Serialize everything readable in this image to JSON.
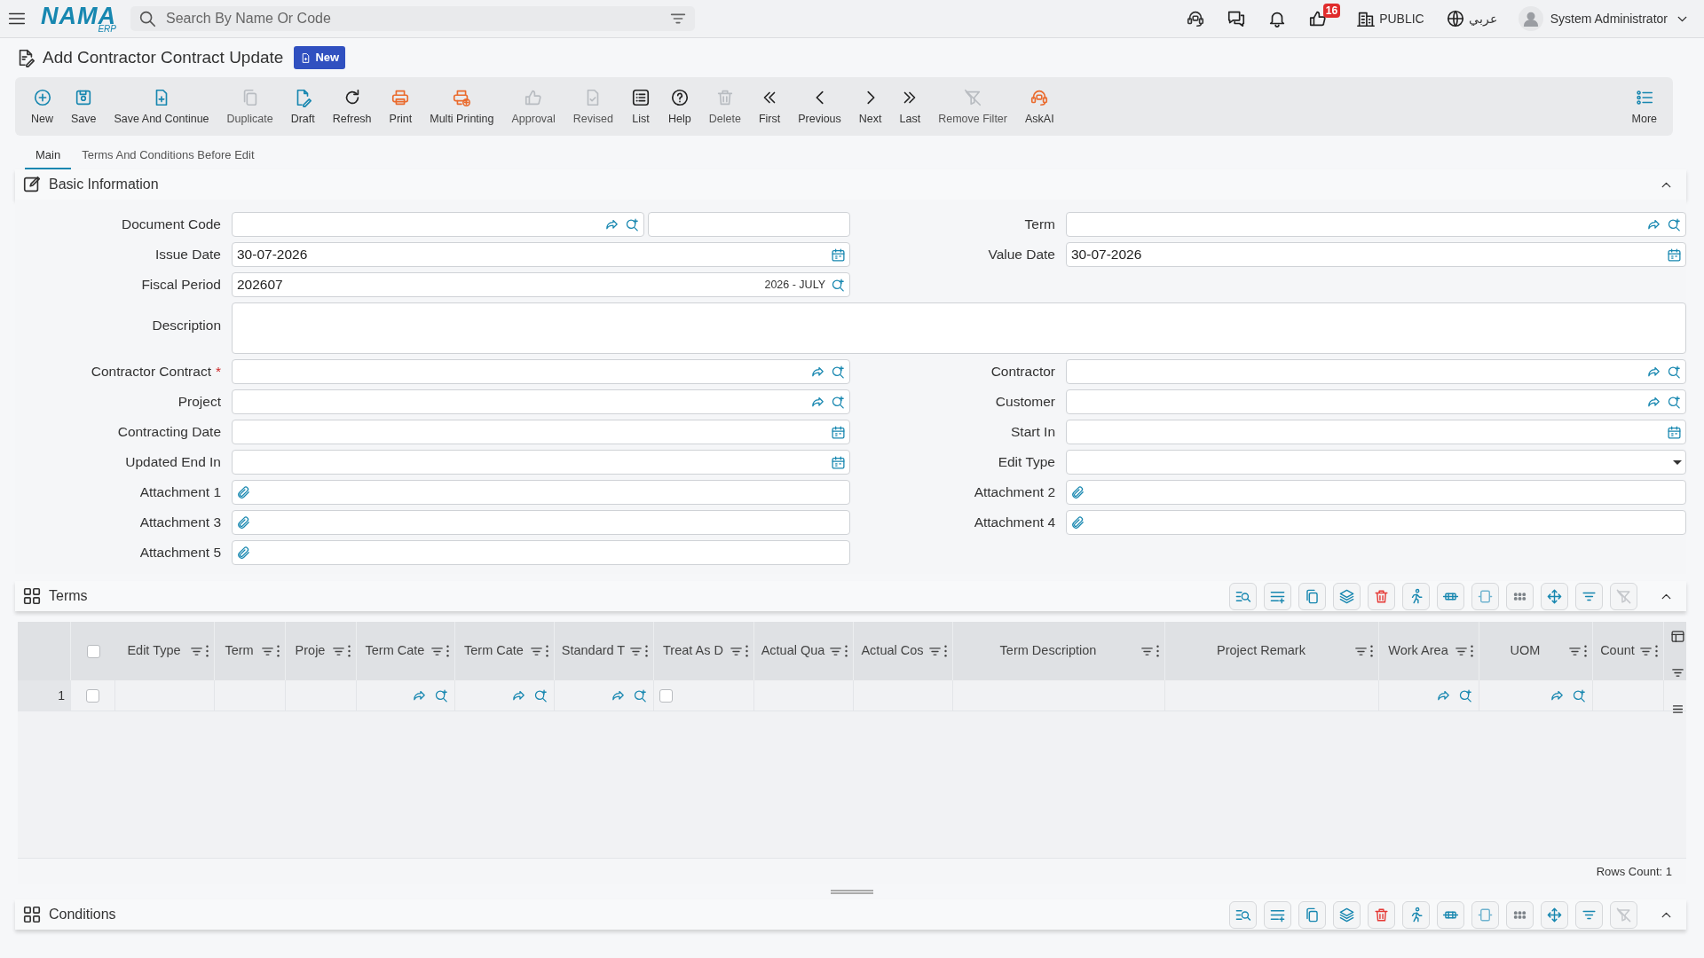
{
  "topbar": {
    "logo": {
      "name": "NAMA",
      "suffix": "ERP"
    },
    "search": {
      "placeholder": "Search By Name Or Code"
    },
    "likes_badge": "16",
    "company": "PUBLIC",
    "language": "عربي",
    "user": "System Administrator"
  },
  "page": {
    "title": "Add Contractor Contract Update",
    "status": "New"
  },
  "toolbar": [
    {
      "label": "New",
      "disabled": false
    },
    {
      "label": "Save",
      "disabled": false
    },
    {
      "label": "Save And Continue",
      "disabled": false
    },
    {
      "label": "Duplicate",
      "disabled": true
    },
    {
      "label": "Draft",
      "disabled": false
    },
    {
      "label": "Refresh",
      "disabled": false
    },
    {
      "label": "Print",
      "disabled": false
    },
    {
      "label": "Multi Printing",
      "disabled": false
    },
    {
      "label": "Approval",
      "disabled": true
    },
    {
      "label": "Revised",
      "disabled": true
    },
    {
      "label": "List",
      "disabled": false
    },
    {
      "label": "Help",
      "disabled": false
    },
    {
      "label": "Delete",
      "disabled": true
    },
    {
      "label": "First",
      "disabled": false
    },
    {
      "label": "Previous",
      "disabled": false
    },
    {
      "label": "Next",
      "disabled": false
    },
    {
      "label": "Last",
      "disabled": false
    },
    {
      "label": "Remove Filter",
      "disabled": true
    },
    {
      "label": "AskAI",
      "disabled": false
    },
    {
      "label": "More",
      "disabled": false
    }
  ],
  "tabs": [
    {
      "label": "Main",
      "selected": true
    },
    {
      "label": "Terms And Conditions Before Edit",
      "selected": false
    }
  ],
  "basic_information": {
    "title": "Basic Information",
    "expanded": true,
    "rows": [
      [
        {
          "label": "Document Code",
          "kind": "lookup_pair"
        },
        {
          "label": "Term",
          "kind": "lookup"
        }
      ],
      [
        {
          "label": "Issue Date",
          "kind": "date",
          "value": "30-07-2026"
        },
        {
          "label": "Value Date",
          "kind": "date",
          "value": "30-07-2026"
        }
      ],
      [
        {
          "label": "Fiscal Period",
          "kind": "period",
          "value": "202607",
          "period_name": "2026 - JULY"
        }
      ],
      [
        {
          "label": "Description",
          "kind": "textarea"
        }
      ],
      [
        {
          "label": "Contractor Contract",
          "kind": "lookup",
          "required_mark": "*"
        },
        {
          "label": "Contractor",
          "kind": "lookup"
        }
      ],
      [
        {
          "label": "Project",
          "kind": "lookup"
        },
        {
          "label": "Customer",
          "kind": "lookup"
        }
      ],
      [
        {
          "label": "Contracting Date",
          "kind": "date"
        },
        {
          "label": "Start In",
          "kind": "date"
        }
      ],
      [
        {
          "label": "Updated End In",
          "kind": "date"
        },
        {
          "label": "Edit Type",
          "kind": "select"
        }
      ],
      [
        {
          "label": "Attachment 1",
          "kind": "attachment"
        },
        {
          "label": "Attachment 2",
          "kind": "attachment"
        }
      ],
      [
        {
          "label": "Attachment 3",
          "kind": "attachment"
        },
        {
          "label": "Attachment 4",
          "kind": "attachment"
        }
      ],
      [
        {
          "label": "Attachment 5",
          "kind": "attachment"
        }
      ]
    ]
  },
  "terms": {
    "title": "Terms",
    "expanded": true,
    "tools": [
      {
        "disabled": false
      },
      {
        "disabled": false
      },
      {
        "disabled": false
      },
      {
        "disabled": false
      },
      {
        "disabled": false
      },
      {
        "disabled": false
      },
      {
        "disabled": false
      },
      {
        "disabled": false
      },
      {
        "disabled": false
      },
      {
        "disabled": false
      },
      {
        "disabled": false
      },
      {
        "disabled": true
      }
    ],
    "all_checked": false,
    "columns": [
      "Edit Type",
      "Term",
      "Proje",
      "Term Cate",
      "Term Cate",
      "Standard T",
      "Treat As D",
      "Actual Qua",
      "Actual Cos",
      "Term Description",
      "Project Remark",
      "Work Area",
      "UOM",
      "Count"
    ],
    "rows": [
      {
        "number": "1",
        "checked": false,
        "cells": [
          {
            "kind": "text"
          },
          {
            "kind": "text"
          },
          {
            "kind": "text"
          },
          {
            "kind": "lookup"
          },
          {
            "kind": "lookup"
          },
          {
            "kind": "lookup"
          },
          {
            "kind": "checkbox",
            "checked": false
          },
          {
            "kind": "text"
          },
          {
            "kind": "text"
          },
          {
            "kind": "text"
          },
          {
            "kind": "text"
          },
          {
            "kind": "lookup"
          },
          {
            "kind": "lookup"
          },
          {
            "kind": "text"
          }
        ]
      }
    ],
    "rows_count": "Rows Count: 1"
  },
  "conditions": {
    "title": "Conditions",
    "expanded": true,
    "tools": [
      {
        "disabled": false
      },
      {
        "disabled": false
      },
      {
        "disabled": false
      },
      {
        "disabled": false
      },
      {
        "disabled": false
      },
      {
        "disabled": false
      },
      {
        "disabled": false
      },
      {
        "disabled": false
      },
      {
        "disabled": false
      },
      {
        "disabled": false
      },
      {
        "disabled": false
      },
      {
        "disabled": true
      }
    ]
  }
}
